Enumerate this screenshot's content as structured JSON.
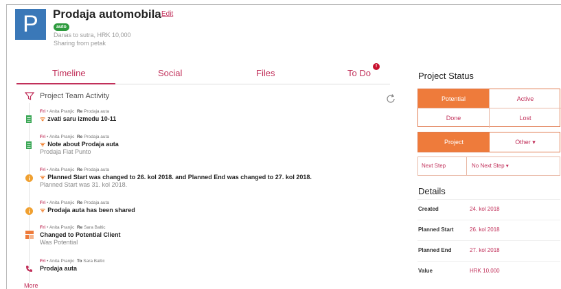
{
  "header": {
    "avatar_letter": "P",
    "title": "Prodaja automobila",
    "edit_label": "Edit",
    "tag": "auto",
    "meta_line1": "Danas to sutra, HRK 10,000",
    "meta_line2": "Sharing from petak"
  },
  "tabs": [
    {
      "label": "Timeline",
      "active": true
    },
    {
      "label": "Social"
    },
    {
      "label": "Files"
    },
    {
      "label": "To Do",
      "badge": "!"
    }
  ],
  "activity": {
    "header": "Project Team Activity",
    "more_label": "More",
    "items": [
      {
        "day": "Fri",
        "who": "Anita Pranjic",
        "re_label": "Re",
        "re": "Prodaja auta",
        "main": "zvati saru izmedu 10-11",
        "sub": ""
      },
      {
        "day": "Fri",
        "who": "Anita Pranjic",
        "re_label": "Re",
        "re": "Prodaja auta",
        "main": "Note about Prodaja auta",
        "sub": "Prodaja Fiat Punto"
      },
      {
        "day": "Fri",
        "who": "Anita Pranjic",
        "re_label": "Re",
        "re": "Prodaja auta",
        "main": "Planned Start was changed to 26. kol 2018. and Planned End was changed to 27. kol 2018.",
        "sub": "Planned Start was 31. kol 2018."
      },
      {
        "day": "Fri",
        "who": "Anita Pranjic",
        "re_label": "Re",
        "re": "Prodaja auta",
        "main": "Prodaja auta has been shared",
        "sub": ""
      },
      {
        "day": "Fri",
        "who": "Anita Pranjic",
        "re_label": "Re",
        "re": "Sara Baltic",
        "main": "Changed to Potential Client",
        "sub": "Was Potential"
      },
      {
        "day": "Fri",
        "who": "Anita Pranjic",
        "re_label": "To",
        "re": "Sara Baltic",
        "main": "Prodaja auta",
        "sub": ""
      }
    ]
  },
  "project_status": {
    "title": "Project Status",
    "statuses": [
      "Potential",
      "Active",
      "Done",
      "Lost"
    ],
    "selected_status": "Potential",
    "type_selected": "Project",
    "type_other": "Other ▾",
    "next_step_label": "Next Step",
    "next_step_value": "No Next Step ▾"
  },
  "details": {
    "title": "Details",
    "rows": [
      {
        "label": "Created",
        "value": "24. kol 2018"
      },
      {
        "label": "Planned Start",
        "value": "26. kol 2018"
      },
      {
        "label": "Planned End",
        "value": "27. kol 2018"
      },
      {
        "label": "Value",
        "value": "HRK 10,000"
      }
    ]
  },
  "colors": {
    "accent": "#c1305a",
    "orange": "#ee7b3b",
    "avatar": "#3a78b8",
    "tag": "#2e9b3e"
  }
}
